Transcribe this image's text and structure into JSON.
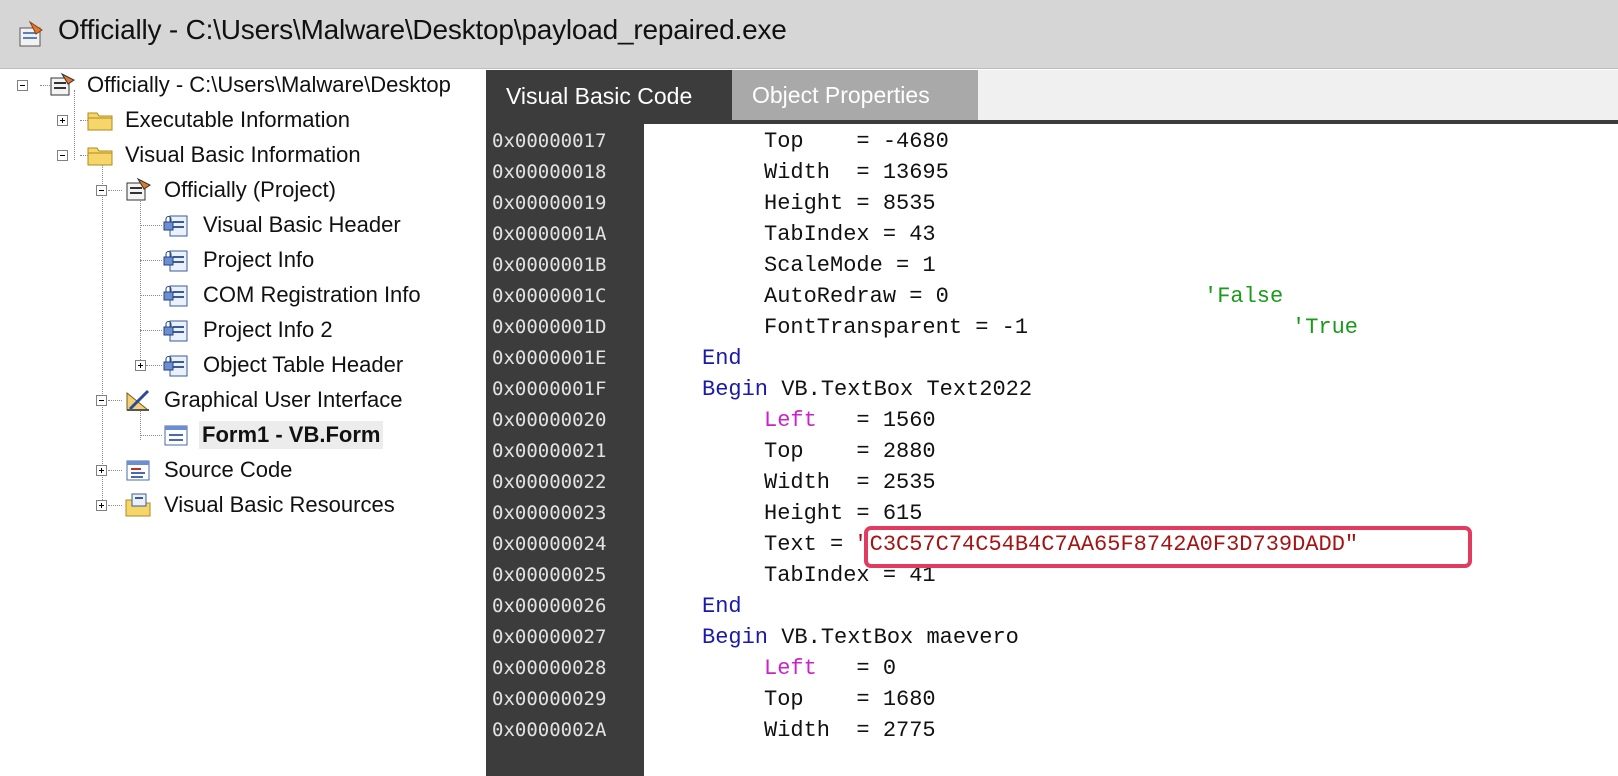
{
  "window": {
    "title": "Officially - C:\\Users\\Malware\\Desktop\\payload_repaired.exe"
  },
  "tree": {
    "items": [
      {
        "label": "Officially - C:\\Users\\Malware\\Desktop"
      },
      {
        "label": "Executable Information"
      },
      {
        "label": "Visual Basic Information"
      },
      {
        "label": "Officially (Project)"
      },
      {
        "label": "Visual Basic Header"
      },
      {
        "label": "Project Info"
      },
      {
        "label": "COM Registration Info"
      },
      {
        "label": "Project Info 2"
      },
      {
        "label": "Object Table Header"
      },
      {
        "label": "Graphical User Interface"
      },
      {
        "label": "Form1 - VB.Form"
      },
      {
        "label": "Source Code"
      },
      {
        "label": "Visual Basic Resources"
      }
    ]
  },
  "tabs": {
    "code": "Visual Basic Code",
    "properties": "Object Properties"
  },
  "code": {
    "lines": [
      {
        "addr": "0x00000017",
        "name": "Top",
        "pad": "    ",
        "op": "= ",
        "value": "-4680"
      },
      {
        "addr": "0x00000018",
        "name": "Width",
        "pad": "  ",
        "op": "= ",
        "value": "13695"
      },
      {
        "addr": "0x00000019",
        "name": "Height",
        "pad": " ",
        "op": "= ",
        "value": "8535"
      },
      {
        "addr": "0x0000001A",
        "name": "TabIndex",
        "pad": " ",
        "op": "= ",
        "value": "43"
      },
      {
        "addr": "0x0000001B",
        "name": "ScaleMode",
        "pad": " ",
        "op": "= ",
        "value": "1"
      },
      {
        "addr": "0x0000001C",
        "name": "AutoRedraw",
        "pad": " ",
        "op": "= ",
        "value": "0",
        "comment": "'False"
      },
      {
        "addr": "0x0000001D",
        "name": "FontTransparent",
        "pad": " ",
        "op": "= ",
        "value": "-1",
        "comment": "'True"
      },
      {
        "addr": "0x0000001E",
        "kw": "End"
      },
      {
        "addr": "0x0000001F",
        "kw": "Begin",
        "rest": " VB.TextBox Text2022"
      },
      {
        "addr": "0x00000020",
        "name": "Left",
        "pad": "   ",
        "op": "= ",
        "value": "1560"
      },
      {
        "addr": "0x00000021",
        "name": "Top",
        "pad": "    ",
        "op": "= ",
        "value": "2880"
      },
      {
        "addr": "0x00000022",
        "name": "Width",
        "pad": "  ",
        "op": "= ",
        "value": "2535"
      },
      {
        "addr": "0x00000023",
        "name": "Height",
        "pad": " ",
        "op": "= ",
        "value": "615"
      },
      {
        "addr": "0x00000024",
        "name": "Text",
        "pad": " ",
        "op": "= ",
        "string": "\"C3C57C74C54B4C7AA65F8742A0F3D739DADD\""
      },
      {
        "addr": "0x00000025",
        "name": "TabIndex",
        "pad": " ",
        "op": "= ",
        "value": "41"
      },
      {
        "addr": "0x00000026",
        "kw": "End"
      },
      {
        "addr": "0x00000027",
        "kw": "Begin",
        "rest": " VB.TextBox maevero"
      },
      {
        "addr": "0x00000028",
        "name": "Left",
        "pad": "   ",
        "op": "= ",
        "value": "0"
      },
      {
        "addr": "0x00000029",
        "name": "Top",
        "pad": "    ",
        "op": "= ",
        "value": "1680"
      },
      {
        "addr": "0x0000002A",
        "name": "Width",
        "pad": "  ",
        "op": "= ",
        "value": "2775"
      }
    ]
  },
  "colors": {
    "accent_highlight": "#e23b5f",
    "keyword": "#1a1aa6",
    "property_left": "#cc22cc",
    "string": "#a31515",
    "comment": "#1a9a1a",
    "gutter": "#3c3c3c"
  }
}
